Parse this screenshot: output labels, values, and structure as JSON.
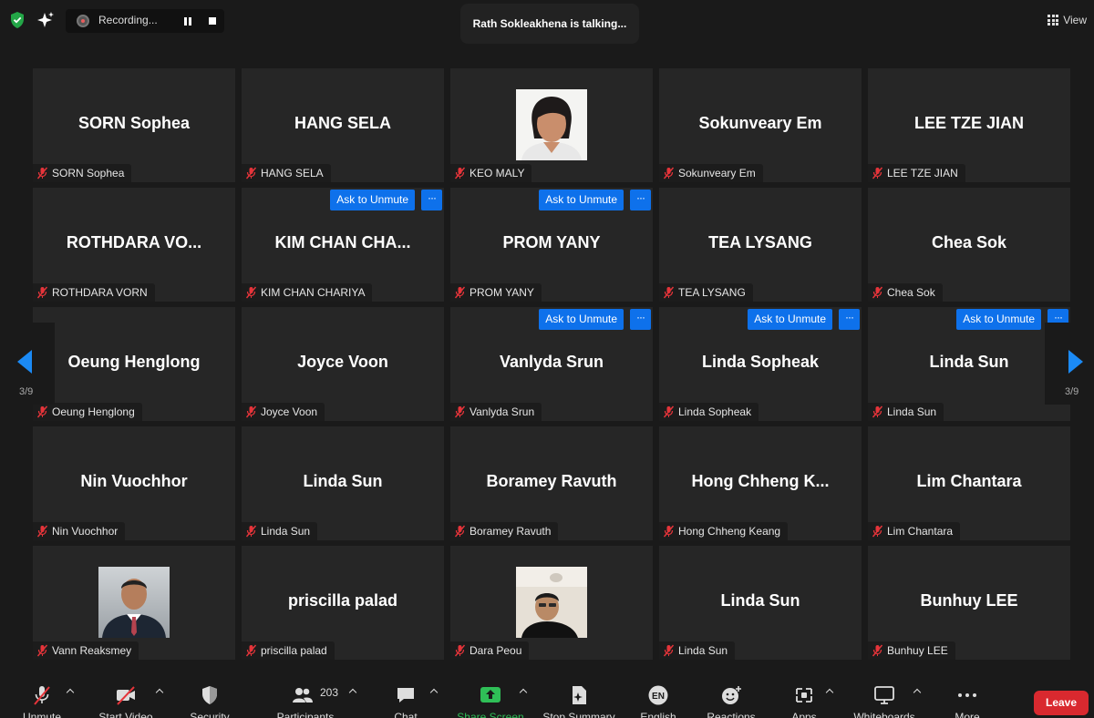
{
  "topbar": {
    "recording_label": "Recording...",
    "talking": "Rath Sokleakhena is talking...",
    "view_label": "View"
  },
  "tiles": [
    {
      "display": "SORN Sophea",
      "label": "SORN Sophea"
    },
    {
      "display": "HANG SELA",
      "label": "HANG SELA"
    },
    {
      "display": "",
      "label": "KEO MALY",
      "photo": "woman-portrait"
    },
    {
      "display": "Sokunveary Em",
      "label": "Sokunveary Em"
    },
    {
      "display": "LEE TZE JIAN",
      "label": "LEE TZE JIAN"
    },
    {
      "display": "ROTHDARA  VO...",
      "label": "ROTHDARA VORN"
    },
    {
      "display": "KIM  CHAN  CHA...",
      "label": "KIM CHAN CHARIYA",
      "ask": "Ask to Unmute"
    },
    {
      "display": "PROM YANY",
      "label": "PROM YANY",
      "ask": "Ask to Unmute"
    },
    {
      "display": "TEA LYSANG",
      "label": "TEA LYSANG"
    },
    {
      "display": "Chea Sok",
      "label": "Chea Sok"
    },
    {
      "display": "Oeung Henglong",
      "label": "Oeung Henglong"
    },
    {
      "display": "Joyce Voon",
      "label": "Joyce Voon"
    },
    {
      "display": "Vanlyda Srun",
      "label": "Vanlyda Srun",
      "ask": "Ask to Unmute"
    },
    {
      "display": "Linda Sopheak",
      "label": "Linda Sopheak",
      "ask": "Ask to Unmute"
    },
    {
      "display": "Linda Sun",
      "label": "Linda Sun",
      "ask": "Ask to Unmute"
    },
    {
      "display": "Nin Vuochhor",
      "label": "Nin Vuochhor"
    },
    {
      "display": "Linda Sun",
      "label": "Linda Sun"
    },
    {
      "display": "Boramey Ravuth",
      "label": "Boramey Ravuth"
    },
    {
      "display": "Hong  Chheng  K...",
      "label": "Hong Chheng Keang"
    },
    {
      "display": "Lim Chantara",
      "label": "Lim Chantara"
    },
    {
      "display": "",
      "label": "Vann Reaksmey",
      "photo": "man-portrait"
    },
    {
      "display": "priscilla palad",
      "label": "priscilla palad"
    },
    {
      "display": "",
      "label": "Dara Peou",
      "photo": "man-selfie"
    },
    {
      "display": "Linda Sun",
      "label": "Linda Sun"
    },
    {
      "display": "Bunhuy LEE",
      "label": "Bunhuy LEE"
    }
  ],
  "more_glyph": "···",
  "pagination": {
    "left": "3/9",
    "right": "3/9"
  },
  "toolbar": {
    "unmute": "Unmute",
    "start_video": "Start Video",
    "security": "Security",
    "participants": "Participants",
    "participants_count": "203",
    "chat": "Chat",
    "share_screen": "Share Screen",
    "stop_summary": "Stop Summary",
    "english": "English",
    "english_badge": "EN",
    "reactions": "Reactions",
    "apps": "Apps",
    "whiteboards": "Whiteboards",
    "more": "More",
    "leave": "Leave"
  },
  "colors": {
    "accent": "#0e71eb",
    "leave": "#d9292f",
    "share": "#2fbf57",
    "tile": "#262626",
    "background": "#1a1a1a"
  }
}
